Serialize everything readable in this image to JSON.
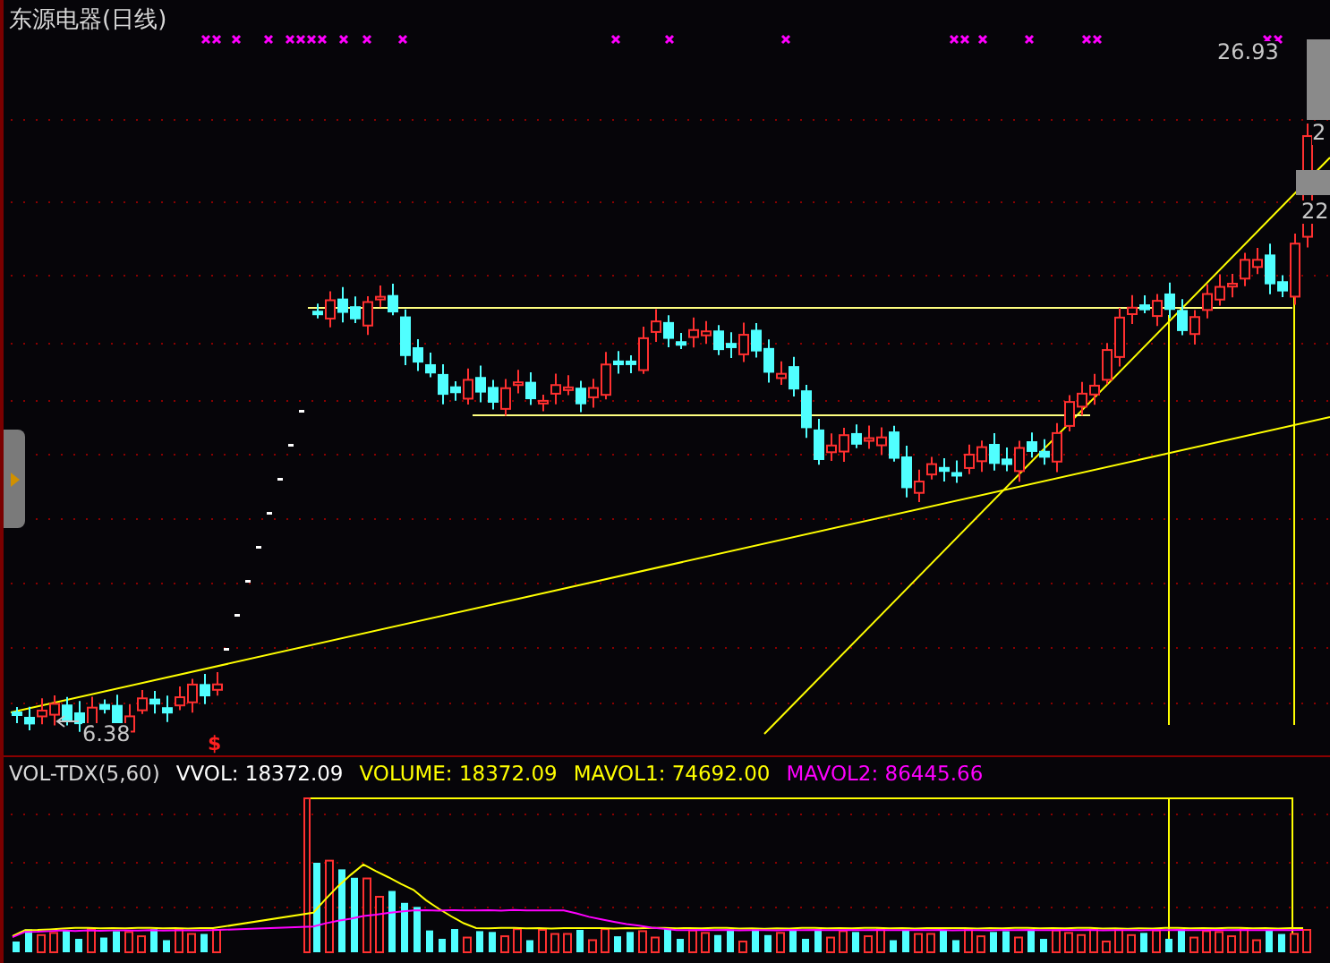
{
  "title": "东源电器(日线)",
  "price_labels": {
    "high": "26.93",
    "low": "6.38"
  },
  "axis_labels": [
    "2",
    "22"
  ],
  "signal_mark": "$",
  "indicator": [
    {
      "text": "VOL-TDX(5,60)",
      "color": "#d8d8d8"
    },
    {
      "text": "VVOL: 18372.09",
      "color": "#ffffff"
    },
    {
      "text": "VOLUME: 18372.09",
      "color": "#ffff00"
    },
    {
      "text": "MAVOL1: 74692.00",
      "color": "#ffff00"
    },
    {
      "text": "MAVOL2: 86445.66",
      "color": "#ff00ff"
    }
  ]
}
